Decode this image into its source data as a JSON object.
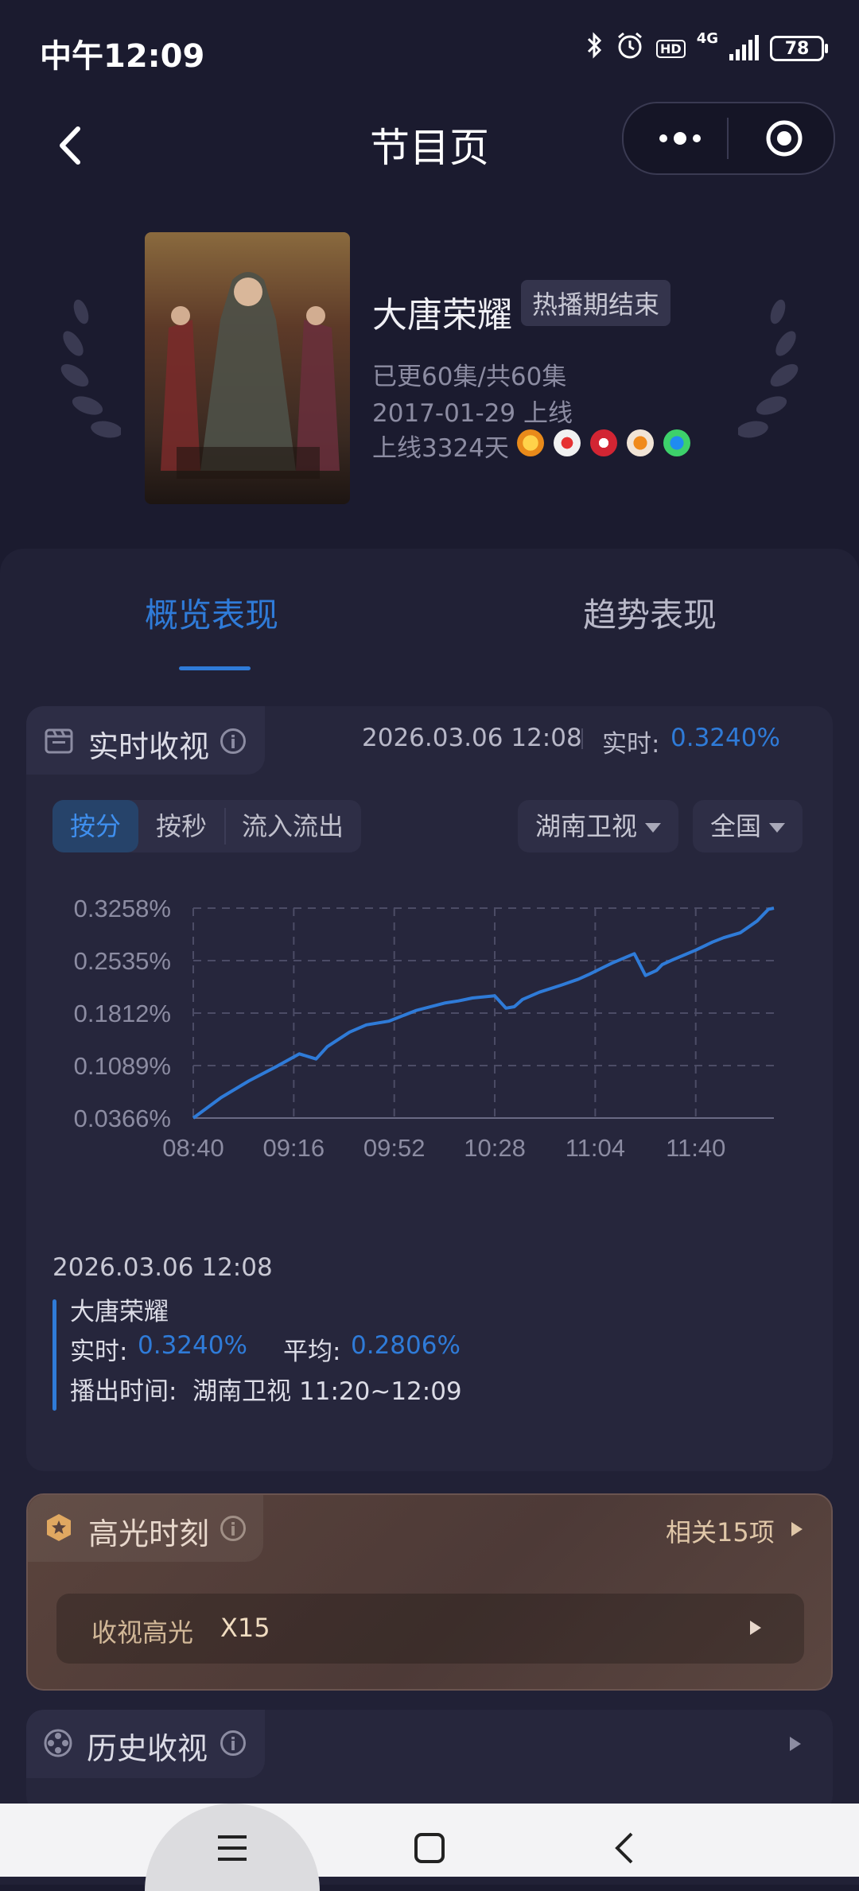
{
  "status_bar": {
    "time": "中午12:09",
    "network": "4G",
    "battery": "78"
  },
  "title_bar": {
    "title": "节目页"
  },
  "show": {
    "name": "大唐荣耀",
    "status_tag": "热播期结束",
    "episodes": "已更60集/共60集",
    "premiere": "2017-01-29 上线",
    "days_online": "上线3324天",
    "platforms": [
      "platform-1-icon",
      "platform-2-icon",
      "platform-3-icon",
      "platform-4-icon",
      "platform-5-icon"
    ]
  },
  "tabs": [
    {
      "label": "概览表现",
      "active": true
    },
    {
      "label": "趋势表现",
      "active": false
    }
  ],
  "realtime": {
    "title": "实时收视",
    "timestamp": "2026.03.06 12:08",
    "rt_label": "实时:",
    "rt_value": "0.3240%",
    "modes": [
      "按分",
      "按秒",
      "流入流出"
    ],
    "channel": "湖南卫视",
    "region": "全国",
    "detail": {
      "time": "2026.03.06 12:08",
      "name": "大唐荣耀",
      "rt_label": "实时:",
      "rt_value": "0.3240%",
      "avg_label": "平均:",
      "avg_value": "0.2806%",
      "airtime": "播出时间:  湖南卫视 11:20~12:09"
    }
  },
  "chart_data": {
    "type": "line",
    "y_ticks": [
      "0.3258%",
      "0.2535%",
      "0.1812%",
      "0.1089%",
      "0.0366%"
    ],
    "x_ticks": [
      "08:40",
      "09:16",
      "09:52",
      "10:28",
      "11:04",
      "11:40"
    ],
    "ylim": [
      0.0366,
      0.3258
    ],
    "x_range_minutes": [
      0,
      208
    ],
    "grid": true,
    "series": [
      {
        "x": [
          0,
          10,
          20,
          30,
          38,
          44,
          48,
          56,
          62,
          70,
          80,
          90,
          95,
          100,
          108,
          112,
          115,
          118,
          124,
          132,
          138,
          142,
          150,
          158,
          162,
          166,
          168,
          172,
          180,
          186,
          190,
          196,
          202,
          206,
          208
        ],
        "values": [
          0.0366,
          0.065,
          0.088,
          0.108,
          0.125,
          0.118,
          0.135,
          0.155,
          0.165,
          0.17,
          0.185,
          0.195,
          0.198,
          0.202,
          0.205,
          0.188,
          0.19,
          0.2,
          0.21,
          0.22,
          0.228,
          0.235,
          0.25,
          0.263,
          0.233,
          0.24,
          0.248,
          0.255,
          0.268,
          0.279,
          0.285,
          0.292,
          0.308,
          0.324,
          0.3258
        ]
      }
    ]
  },
  "highlight": {
    "title": "高光时刻",
    "related": "相关15项",
    "item_label": "收视高光",
    "item_count": "X15"
  },
  "history": {
    "title": "历史收视"
  },
  "colors": {
    "accent": "#2f7bd8",
    "background": "#1b1b2f",
    "panel": "#212136",
    "highlight_bg": "#5a433c"
  }
}
